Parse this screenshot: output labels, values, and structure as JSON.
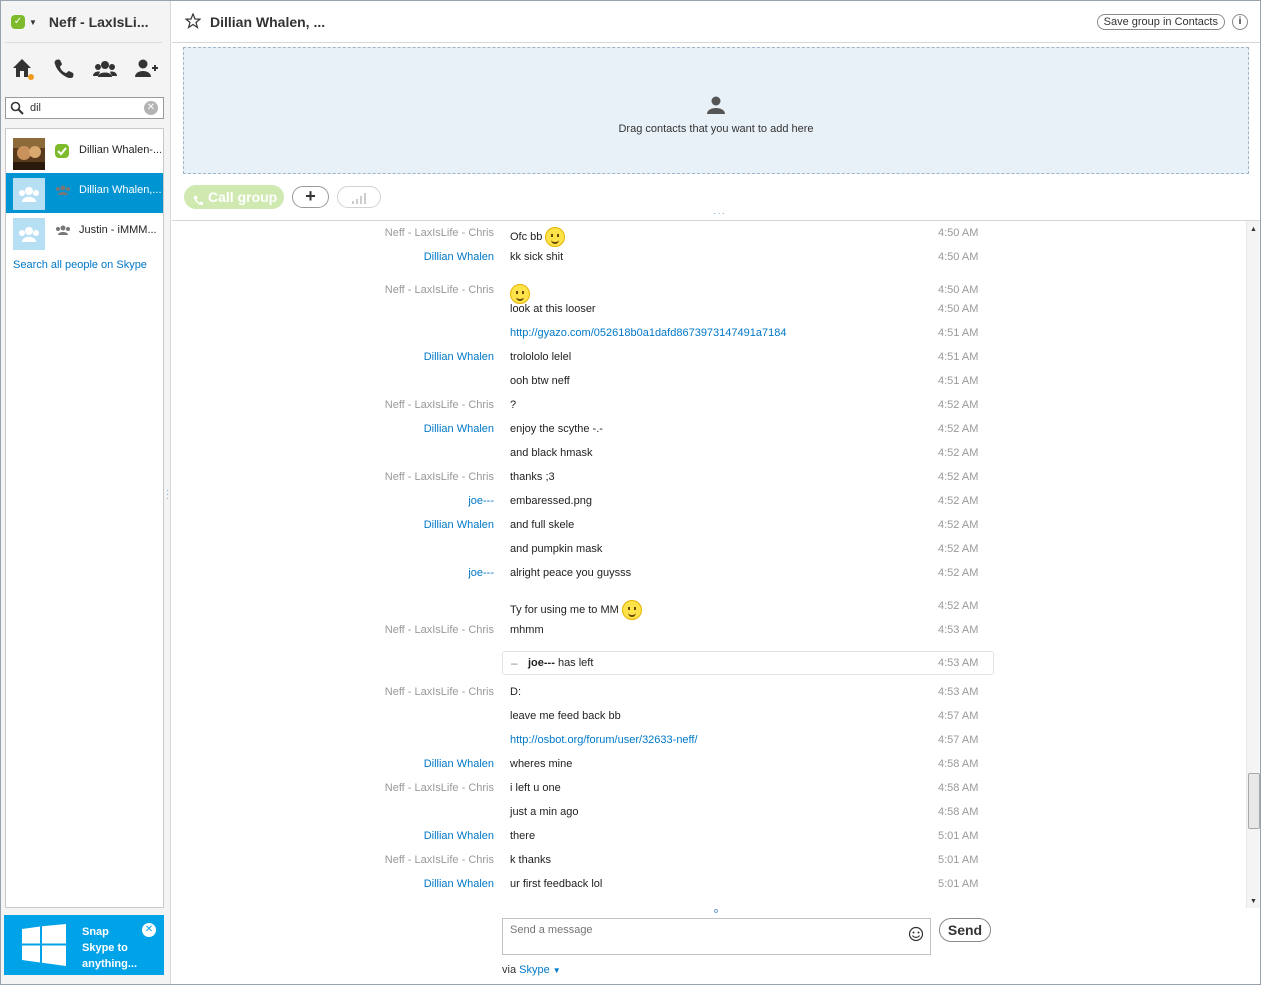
{
  "profile": {
    "name": "Neff - LaxIsLi..."
  },
  "search": {
    "value": "dil"
  },
  "contacts": [
    {
      "name": "Dillian Whalen-..."
    },
    {
      "name": "Dillian Whalen,..."
    },
    {
      "name": "Justin - iMMM..."
    }
  ],
  "search_all": "Search all people on Skype",
  "snap": {
    "line1": "Snap",
    "line2": "Skype to",
    "line3": "anything..."
  },
  "header": {
    "title": "Dillian Whalen, ...",
    "save_group": "Save group in Contacts",
    "info": "i"
  },
  "drop_zone": {
    "text": "Drag contacts that you want to add here"
  },
  "controls": {
    "call_group": "Call group",
    "add": "+"
  },
  "messages": [
    {
      "sender": "Neff - LaxIsLife  - Chris",
      "role": "neff",
      "text": "Ofc bb",
      "emoji": true,
      "time": "4:50 AM"
    },
    {
      "sender": "Dillian Whalen",
      "role": "dillian",
      "text": "kk sick shit",
      "time": "4:50 AM"
    },
    {
      "sender": "Neff - LaxIsLife  - Chris",
      "role": "neff",
      "text": "",
      "emoji": true,
      "time": "4:50 AM"
    },
    {
      "sender": "",
      "role": "neff",
      "text": "look at this looser",
      "time": "4:50 AM"
    },
    {
      "sender": "",
      "role": "neff",
      "text": "http://gyazo.com/052618b0a1dafd8673973147491a7184",
      "link": true,
      "time": "4:51 AM"
    },
    {
      "sender": "Dillian Whalen",
      "role": "dillian",
      "text": "trolololo lelel",
      "time": "4:51 AM"
    },
    {
      "sender": "",
      "role": "dillian",
      "text": "ooh btw neff",
      "time": "4:51 AM"
    },
    {
      "sender": "Neff - LaxIsLife  - Chris",
      "role": "neff",
      "text": "?",
      "time": "4:52 AM"
    },
    {
      "sender": "Dillian Whalen",
      "role": "dillian",
      "text": "enjoy the scythe -.-",
      "time": "4:52 AM"
    },
    {
      "sender": "",
      "role": "dillian",
      "text": "and black hmask",
      "time": "4:52 AM"
    },
    {
      "sender": "Neff - LaxIsLife  - Chris",
      "role": "neff",
      "text": "thanks ;3",
      "time": "4:52 AM"
    },
    {
      "sender": "joe---",
      "role": "joe",
      "text": "embaressed.png",
      "time": "4:52 AM"
    },
    {
      "sender": "Dillian Whalen",
      "role": "dillian",
      "text": "and full skele",
      "time": "4:52 AM"
    },
    {
      "sender": "",
      "role": "dillian",
      "text": "and pumpkin mask",
      "time": "4:52 AM"
    },
    {
      "sender": "joe---",
      "role": "joe",
      "text": "alright peace you guysss",
      "time": "4:52 AM"
    },
    {
      "sender": "",
      "role": "joe",
      "text": "Ty for using me to MM",
      "emoji": true,
      "time": "4:52 AM"
    },
    {
      "sender": "Neff - LaxIsLife  - Chris",
      "role": "neff",
      "text": "mhmm",
      "time": "4:53 AM"
    },
    {
      "event": true,
      "actor": "joe---",
      "text": " has left",
      "time": "4:53 AM"
    },
    {
      "sender": "Neff - LaxIsLife  - Chris",
      "role": "neff",
      "text": "D:",
      "time": "4:53 AM"
    },
    {
      "sender": "",
      "role": "neff",
      "text": "leave me feed back bb",
      "time": "4:57 AM"
    },
    {
      "sender": "",
      "role": "neff",
      "text": "http://osbot.org/forum/user/32633-neff/",
      "link": true,
      "time": "4:57 AM"
    },
    {
      "sender": "Dillian Whalen",
      "role": "dillian",
      "text": "wheres mine",
      "time": "4:58 AM"
    },
    {
      "sender": "Neff - LaxIsLife  - Chris",
      "role": "neff",
      "text": "i left u one",
      "time": "4:58 AM"
    },
    {
      "sender": "",
      "role": "neff",
      "text": "just a min ago",
      "time": "4:58 AM"
    },
    {
      "sender": "Dillian Whalen",
      "role": "dillian",
      "text": "there",
      "time": "5:01 AM"
    },
    {
      "sender": "Neff - LaxIsLife  - Chris",
      "role": "neff",
      "text": "k thanks",
      "time": "5:01 AM"
    },
    {
      "sender": "Dillian Whalen",
      "role": "dillian",
      "text": "ur first feedback lol",
      "time": "5:01 AM"
    }
  ],
  "composer": {
    "placeholder": "Send a message",
    "send": "Send",
    "via_prefix": "via",
    "via_link": "Skype"
  },
  "colors": {
    "accent": "#0094d3",
    "link": "#0078c8",
    "presence": "#7dbb2c",
    "snap": "#00a2e8"
  }
}
